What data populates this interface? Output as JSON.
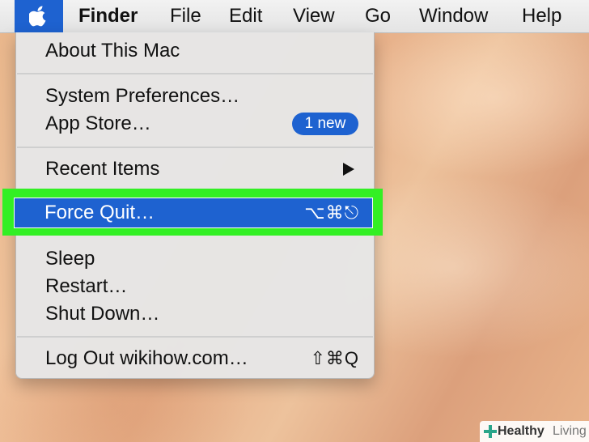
{
  "menubar": {
    "apple_icon": "apple-icon",
    "finder": "Finder",
    "file": "File",
    "edit": "Edit",
    "view": "View",
    "go": "Go",
    "window": "Window",
    "help": "Help"
  },
  "apple_menu": {
    "about": "About This Mac",
    "system_preferences": "System Preferences…",
    "app_store": "App Store…",
    "app_store_badge": "1 new",
    "recent_items": "Recent Items",
    "force_quit": "Force Quit…",
    "force_quit_shortcut": "⌥⌘⎋",
    "sleep": "Sleep",
    "restart": "Restart…",
    "shut_down": "Shut Down…",
    "log_out": "Log Out wikihow.com…",
    "log_out_shortcut": "⇧⌘Q"
  },
  "colors": {
    "selection": "#1e62d0",
    "highlight_frame": "#33ef24",
    "menu_background": "#e6e6e6"
  },
  "watermark": {
    "strong": "Healthy",
    "light": "Living"
  }
}
